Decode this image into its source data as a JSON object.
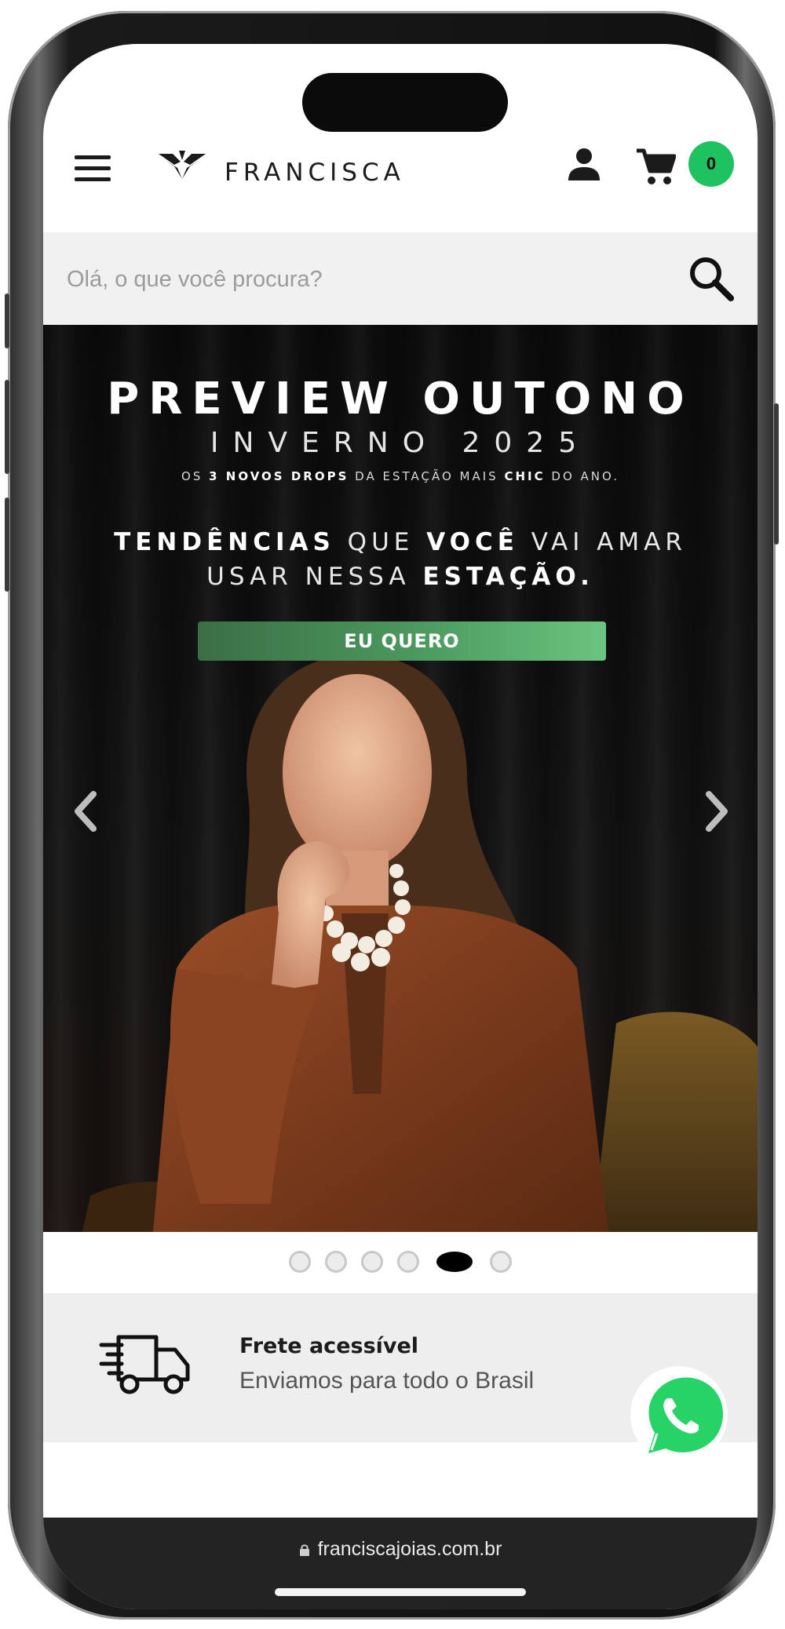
{
  "header": {
    "logo_text": "FRANCISCA",
    "cart_count": "0",
    "cart_badge_color": "#1fc260"
  },
  "search": {
    "placeholder": "Olá, o que você procura?"
  },
  "banner": {
    "title": "PREVIEW OUTONO",
    "subtitle": "INVERNO 2025",
    "small_pre": "OS",
    "small_bold": "3 NOVOS DROPS",
    "small_mid": "DA ESTAÇÃO MAIS",
    "small_bold2": "CHIC",
    "small_post": "DO ANO.",
    "tag_bold1": "TENDÊNCIAS",
    "tag_mid": " QUE ",
    "tag_bold2": "VOCÊ",
    "tag_line1_end": " VAI AMAR",
    "tag_line2_start": "USAR NESSA ",
    "tag_bold3": "ESTAÇÃO.",
    "cta_label": "EU QUERO",
    "cta_color": "#4c9a5f"
  },
  "carousel": {
    "slide_count": 6,
    "active_index": 4,
    "prev_icon": "chevron-left-icon",
    "next_icon": "chevron-right-icon"
  },
  "shipping": {
    "title": "Frete acessível",
    "text": "Enviamos para todo o Brasil",
    "icon": "delivery-truck-icon"
  },
  "browser": {
    "url": "franciscajoias.com.br",
    "lock_icon": "lock-icon"
  },
  "floating": {
    "whatsapp_icon": "whatsapp-icon",
    "whatsapp_color": "#25d366"
  }
}
